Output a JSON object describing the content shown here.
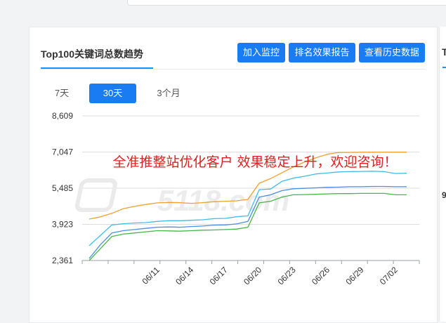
{
  "card": {
    "title": "Top100关键词总数趋势",
    "buttons": {
      "monitor": "加入监控",
      "report": "排名效果报告",
      "history": "查看历史数据"
    },
    "tabs": [
      {
        "label": "7天",
        "active": false
      },
      {
        "label": "30天",
        "active": true
      },
      {
        "label": "3个月",
        "active": false
      }
    ]
  },
  "right_panel": {
    "title_fragment": "T",
    "value_fragment": "9"
  },
  "watermark": "5118.com",
  "colors": {
    "primary": "#1a7cf3",
    "overlay_text": "#e02020"
  },
  "chart_data": {
    "type": "line",
    "annotation": "全准推整站优化客户 效果稳定上升，欢迎咨询！",
    "yticks": [
      2361,
      3923,
      5485,
      7047,
      8609
    ],
    "ylim": [
      2361,
      8609
    ],
    "xticks": [
      "06/11",
      "06/14",
      "06/17",
      "06/20",
      "06/23",
      "06/26",
      "06/29",
      "07/02"
    ],
    "x": [
      "06/05",
      "06/06",
      "06/07",
      "06/08",
      "06/09",
      "06/10",
      "06/11",
      "06/12",
      "06/13",
      "06/14",
      "06/15",
      "06/16",
      "06/17",
      "06/18",
      "06/19",
      "06/20",
      "06/21",
      "06/22",
      "06/23",
      "06/24",
      "06/25",
      "06/26",
      "06/27",
      "06/28",
      "06/29",
      "06/30",
      "07/01",
      "07/02",
      "07/03"
    ],
    "grid": true,
    "series": [
      {
        "color": "#f0a030",
        "values": [
          4150,
          4250,
          4400,
          4600,
          4700,
          4780,
          4850,
          4870,
          4860,
          4830,
          4860,
          4900,
          4920,
          4940,
          5000,
          5700,
          5900,
          6150,
          6400,
          6620,
          6800,
          6950,
          7030,
          7030,
          7040,
          7040,
          7040,
          7040,
          7040
        ]
      },
      {
        "color": "#3dbde8",
        "values": [
          3000,
          3450,
          3900,
          3950,
          3980,
          4000,
          4050,
          4080,
          4080,
          4100,
          4120,
          4170,
          4180,
          4250,
          4290,
          5420,
          5450,
          5780,
          5920,
          6000,
          6100,
          6140,
          6190,
          6200,
          6210,
          6220,
          6200,
          6120,
          6130
        ]
      },
      {
        "color": "#4a8fe8",
        "values": [
          2450,
          3050,
          3550,
          3650,
          3700,
          3750,
          3800,
          3810,
          3800,
          3830,
          3850,
          3890,
          3900,
          3940,
          4050,
          5100,
          5200,
          5380,
          5460,
          5480,
          5500,
          5520,
          5530,
          5550,
          5550,
          5560,
          5560,
          5550,
          5550
        ]
      },
      {
        "color": "#46b846",
        "values": [
          2361,
          2880,
          3400,
          3500,
          3550,
          3600,
          3650,
          3640,
          3630,
          3650,
          3670,
          3680,
          3700,
          3720,
          3800,
          4850,
          4920,
          5100,
          5200,
          5210,
          5220,
          5240,
          5250,
          5250,
          5260,
          5260,
          5260,
          5200,
          5200
        ]
      }
    ]
  }
}
